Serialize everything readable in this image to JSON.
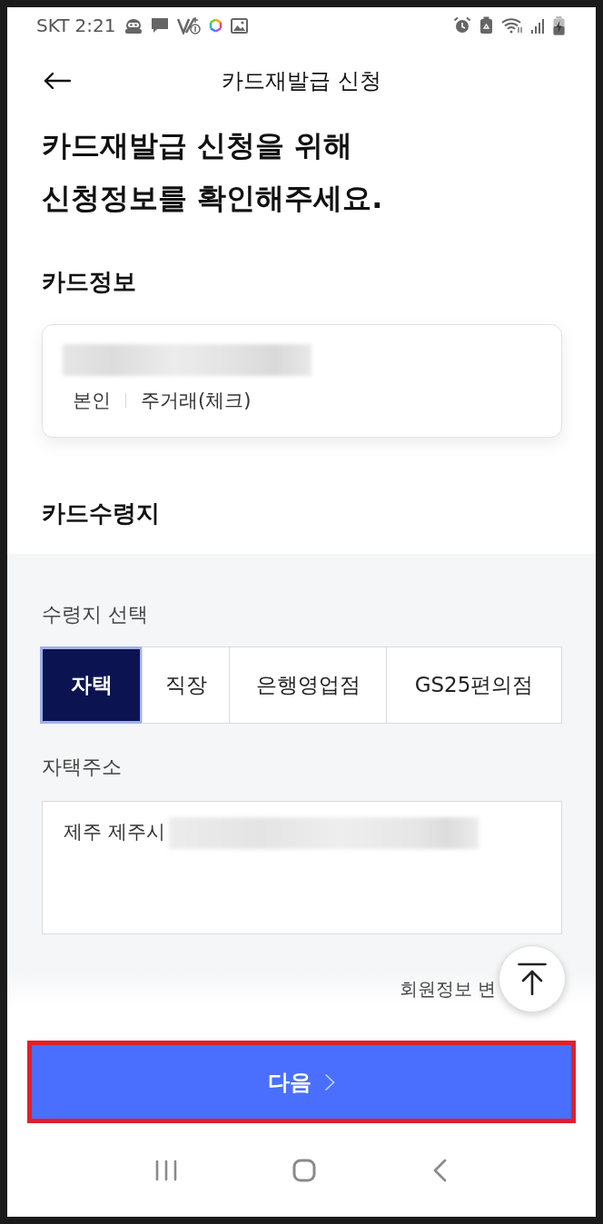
{
  "status_bar": {
    "carrier": "SKT",
    "time": "2:21"
  },
  "header": {
    "title": "카드재발급 신청"
  },
  "heading": "카드재발급 신청을 위해\n신청정보를 확인해주세요.",
  "card_info": {
    "title": "카드정보",
    "tags": [
      "본인",
      "주거래(체크)"
    ]
  },
  "delivery": {
    "title": "카드수령지",
    "select_label": "수령지 선택",
    "options": [
      {
        "label": "자택",
        "selected": true
      },
      {
        "label": "직장",
        "selected": false
      },
      {
        "label": "은행영업점",
        "selected": false
      },
      {
        "label": "GS25편의점",
        "selected": false
      }
    ],
    "address_label": "자택주소",
    "address": "제주 제주시",
    "member_link": "회원정보 변"
  },
  "next_button": {
    "label": "다음"
  }
}
